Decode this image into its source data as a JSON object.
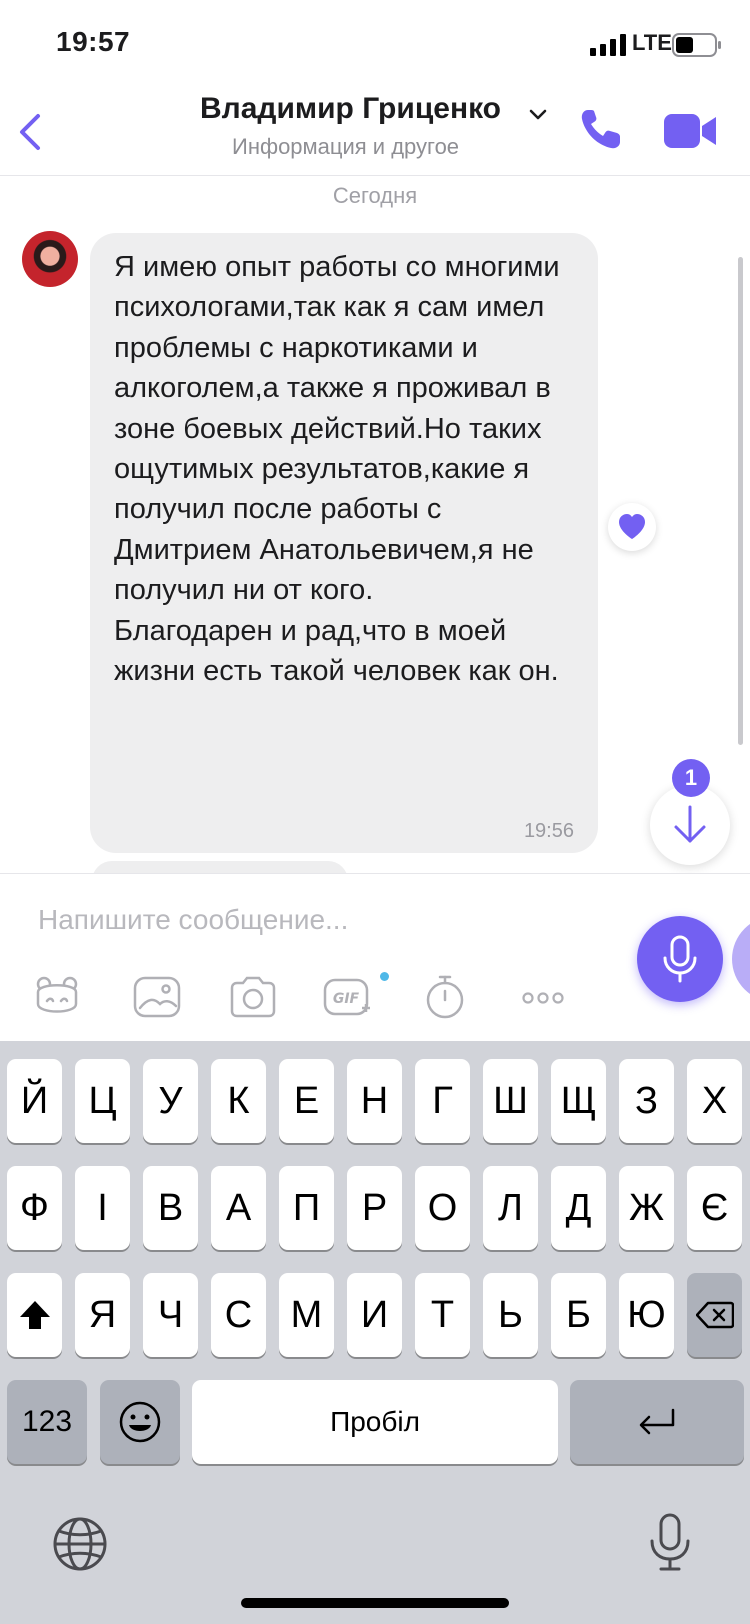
{
  "status_bar": {
    "time": "19:57",
    "network": "LTE",
    "icons": [
      "signal-icon",
      "battery-icon"
    ]
  },
  "header": {
    "contact_name": "Владимир Гриценко",
    "subtitle": "Информация и другое",
    "icons": [
      "back-arrow-icon",
      "chevron-down-icon",
      "phone-icon",
      "video-camera-icon"
    ],
    "accent_color": "#7360f2"
  },
  "chat": {
    "date_divider": "Сегодня",
    "message": {
      "text": "Я имею опыт работы со многими психологами,так как я сам имел проблемы с наркотиками и алкоголем,а также я проживал в зоне боевых действий.Но таких ощутимых результатов,какие я получил после работы с Дмитрием Анатольевичем,я не получил ни от кого.\nБлагодарен и рад,что в моей жизни есть такой человек как он.",
      "time": "19:56",
      "reaction": "heart-icon"
    },
    "unread_count": "1"
  },
  "composer": {
    "placeholder": "Напишите сообщение...",
    "toolbar_icons": [
      "sticker-icon",
      "gallery-icon",
      "camera-icon",
      "gif-icon",
      "timer-icon",
      "more-icon"
    ],
    "voice_icon": "microphone-icon"
  },
  "keyboard": {
    "row1": [
      "Й",
      "Ц",
      "У",
      "К",
      "Е",
      "Н",
      "Г",
      "Ш",
      "Щ",
      "З",
      "Х"
    ],
    "row2": [
      "Ф",
      "І",
      "В",
      "А",
      "П",
      "Р",
      "О",
      "Л",
      "Д",
      "Ж",
      "Є"
    ],
    "row3": [
      "Я",
      "Ч",
      "С",
      "М",
      "И",
      "Т",
      "Ь",
      "Б",
      "Ю"
    ],
    "numbers_label": "123",
    "space_label": "Пробіл",
    "icons": [
      "shift-icon",
      "backspace-icon",
      "emoji-icon",
      "return-icon",
      "globe-icon",
      "dictation-microphone-icon"
    ]
  }
}
